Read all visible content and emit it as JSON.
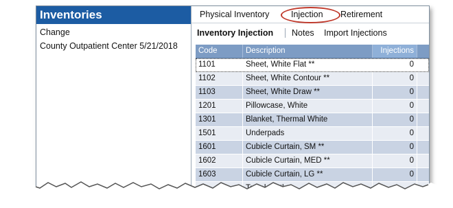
{
  "left_panel": {
    "title": "Inventories",
    "items": [
      "Change",
      "County Outpatient Center 5/21/2018"
    ]
  },
  "top_tabs": [
    "Physical Inventory",
    "Injection",
    "Retirement"
  ],
  "sub_tabs": [
    "Inventory Injection",
    "Notes",
    "Import Injections"
  ],
  "grid": {
    "headers": [
      "Code",
      "Description",
      "Injections"
    ],
    "rows": [
      [
        "1101",
        "Sheet, White Flat **",
        "0"
      ],
      [
        "1102",
        "Sheet, White Contour **",
        "0"
      ],
      [
        "1103",
        "Sheet, White Draw **",
        "0"
      ],
      [
        "1201",
        "Pillowcase, White",
        "0"
      ],
      [
        "1301",
        "Blanket, Thermal White",
        "0"
      ],
      [
        "1501",
        "Underpads",
        "0"
      ],
      [
        "1601",
        "Cubicle Curtain, SM **",
        "0"
      ],
      [
        "1602",
        "Cubicle Curtain, MED **",
        "0"
      ],
      [
        "1603",
        "Cubicle Curtain, LG **",
        "0"
      ],
      [
        "",
        "Towel, Bath",
        ""
      ]
    ]
  },
  "colors": {
    "header_blue": "#1c5ca3",
    "grid_header": "#7d9cc4",
    "highlight_circle": "#c0392b"
  }
}
